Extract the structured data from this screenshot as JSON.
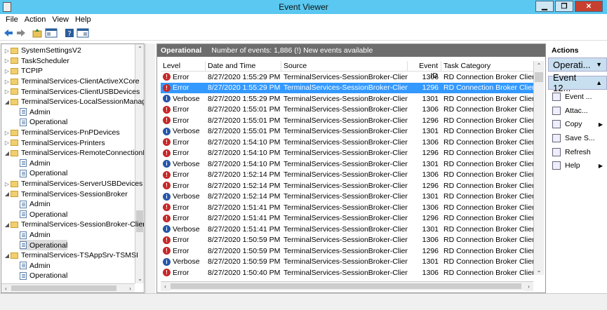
{
  "window": {
    "title": "Event Viewer"
  },
  "menu": [
    "File",
    "Action",
    "View",
    "Help"
  ],
  "tree": [
    {
      "label": "SystemSettingsV2",
      "kind": "folder",
      "expanded": false
    },
    {
      "label": "TaskScheduler",
      "kind": "folder",
      "expanded": false
    },
    {
      "label": "TCPIP",
      "kind": "folder",
      "expanded": false
    },
    {
      "label": "TerminalServices-ClientActiveXCore",
      "kind": "folder",
      "expanded": false
    },
    {
      "label": "TerminalServices-ClientUSBDevices",
      "kind": "folder",
      "expanded": false
    },
    {
      "label": "TerminalServices-LocalSessionManager",
      "kind": "folder",
      "expanded": true
    },
    {
      "label": "Admin",
      "kind": "log",
      "child": true
    },
    {
      "label": "Operational",
      "kind": "log",
      "child": true
    },
    {
      "label": "TerminalServices-PnPDevices",
      "kind": "folder",
      "expanded": false
    },
    {
      "label": "TerminalServices-Printers",
      "kind": "folder",
      "expanded": false
    },
    {
      "label": "TerminalServices-RemoteConnectionMa",
      "kind": "folder",
      "expanded": true
    },
    {
      "label": "Admin",
      "kind": "log",
      "child": true
    },
    {
      "label": "Operational",
      "kind": "log",
      "child": true
    },
    {
      "label": "TerminalServices-ServerUSBDevices",
      "kind": "folder",
      "expanded": false
    },
    {
      "label": "TerminalServices-SessionBroker",
      "kind": "folder",
      "expanded": true
    },
    {
      "label": "Admin",
      "kind": "log",
      "child": true
    },
    {
      "label": "Operational",
      "kind": "log",
      "child": true
    },
    {
      "label": "TerminalServices-SessionBroker-Client",
      "kind": "folder",
      "expanded": true
    },
    {
      "label": "Admin",
      "kind": "log",
      "child": true
    },
    {
      "label": "Operational",
      "kind": "log",
      "child": true,
      "selected": true
    },
    {
      "label": "TerminalServices-TSAppSrv-TSMSI",
      "kind": "folder",
      "expanded": true
    },
    {
      "label": "Admin",
      "kind": "log",
      "child": true
    },
    {
      "label": "Operational",
      "kind": "log",
      "child": true
    }
  ],
  "log_header": {
    "name": "Operational",
    "info": "Number of events: 1,886 (!) New events available"
  },
  "columns": [
    "Level",
    "Date and Time",
    "Source",
    "Event ID",
    "Task Category"
  ],
  "events": [
    {
      "level": "Error",
      "date": "8/27/2020 1:55:29 PM",
      "source": "TerminalServices-SessionBroker-Client",
      "id": "1306",
      "cat": "RD Connection Broker Client..."
    },
    {
      "level": "Error",
      "date": "8/27/2020 1:55:29 PM",
      "source": "TerminalServices-SessionBroker-Client",
      "id": "1296",
      "cat": "RD Connection Broker Client...",
      "selected": true
    },
    {
      "level": "Verbose",
      "date": "8/27/2020 1:55:29 PM",
      "source": "TerminalServices-SessionBroker-Client",
      "id": "1301",
      "cat": "RD Connection Broker Client..."
    },
    {
      "level": "Error",
      "date": "8/27/2020 1:55:01 PM",
      "source": "TerminalServices-SessionBroker-Client",
      "id": "1306",
      "cat": "RD Connection Broker Client..."
    },
    {
      "level": "Error",
      "date": "8/27/2020 1:55:01 PM",
      "source": "TerminalServices-SessionBroker-Client",
      "id": "1296",
      "cat": "RD Connection Broker Client..."
    },
    {
      "level": "Verbose",
      "date": "8/27/2020 1:55:01 PM",
      "source": "TerminalServices-SessionBroker-Client",
      "id": "1301",
      "cat": "RD Connection Broker Client..."
    },
    {
      "level": "Error",
      "date": "8/27/2020 1:54:10 PM",
      "source": "TerminalServices-SessionBroker-Client",
      "id": "1306",
      "cat": "RD Connection Broker Client..."
    },
    {
      "level": "Error",
      "date": "8/27/2020 1:54:10 PM",
      "source": "TerminalServices-SessionBroker-Client",
      "id": "1296",
      "cat": "RD Connection Broker Client..."
    },
    {
      "level": "Verbose",
      "date": "8/27/2020 1:54:10 PM",
      "source": "TerminalServices-SessionBroker-Client",
      "id": "1301",
      "cat": "RD Connection Broker Client..."
    },
    {
      "level": "Error",
      "date": "8/27/2020 1:52:14 PM",
      "source": "TerminalServices-SessionBroker-Client",
      "id": "1306",
      "cat": "RD Connection Broker Client..."
    },
    {
      "level": "Error",
      "date": "8/27/2020 1:52:14 PM",
      "source": "TerminalServices-SessionBroker-Client",
      "id": "1296",
      "cat": "RD Connection Broker Client..."
    },
    {
      "level": "Verbose",
      "date": "8/27/2020 1:52:14 PM",
      "source": "TerminalServices-SessionBroker-Client",
      "id": "1301",
      "cat": "RD Connection Broker Client..."
    },
    {
      "level": "Error",
      "date": "8/27/2020 1:51:41 PM",
      "source": "TerminalServices-SessionBroker-Client",
      "id": "1306",
      "cat": "RD Connection Broker Client..."
    },
    {
      "level": "Error",
      "date": "8/27/2020 1:51:41 PM",
      "source": "TerminalServices-SessionBroker-Client",
      "id": "1296",
      "cat": "RD Connection Broker Client..."
    },
    {
      "level": "Verbose",
      "date": "8/27/2020 1:51:41 PM",
      "source": "TerminalServices-SessionBroker-Client",
      "id": "1301",
      "cat": "RD Connection Broker Client..."
    },
    {
      "level": "Error",
      "date": "8/27/2020 1:50:59 PM",
      "source": "TerminalServices-SessionBroker-Client",
      "id": "1306",
      "cat": "RD Connection Broker Client..."
    },
    {
      "level": "Error",
      "date": "8/27/2020 1:50:59 PM",
      "source": "TerminalServices-SessionBroker-Client",
      "id": "1296",
      "cat": "RD Connection Broker Client..."
    },
    {
      "level": "Verbose",
      "date": "8/27/2020 1:50:59 PM",
      "source": "TerminalServices-SessionBroker-Client",
      "id": "1301",
      "cat": "RD Connection Broker Client..."
    },
    {
      "level": "Error",
      "date": "8/27/2020 1:50:40 PM",
      "source": "TerminalServices-SessionBroker-Client",
      "id": "1306",
      "cat": "RD Connection Broker Client..."
    }
  ],
  "actions": {
    "title": "Actions",
    "group1": "Operati...",
    "group2": "Event 12...",
    "items": [
      {
        "label": "Event ...",
        "icon": "event-properties-icon"
      },
      {
        "label": "Attac...",
        "icon": "attach-task-icon"
      },
      {
        "label": "Copy",
        "icon": "copy-icon",
        "submenu": true
      },
      {
        "label": "Save S...",
        "icon": "save-icon"
      },
      {
        "label": "Refresh",
        "icon": "refresh-icon"
      },
      {
        "label": "Help",
        "icon": "help-icon",
        "submenu": true
      }
    ]
  },
  "colors": {
    "titlebar": "#5ac8f0",
    "selection": "#3399ff",
    "error": "#c62828",
    "verbose": "#2556a8"
  }
}
